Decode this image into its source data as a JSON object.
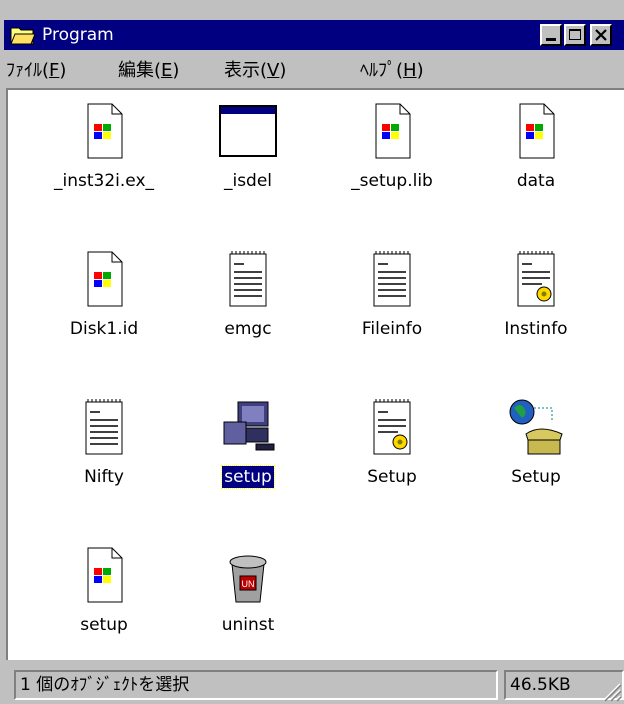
{
  "window": {
    "title": "Program",
    "title_bar_color": "#000080",
    "face_color": "#c0c0c0",
    "title_icon": "folder-open-icon",
    "controls": [
      "minimize",
      "maximize",
      "close"
    ]
  },
  "menu": [
    {
      "text": "ﾌｧｲﾙ",
      "key": "F"
    },
    {
      "text": "編集",
      "key": "E"
    },
    {
      "text": "表示",
      "key": "V"
    },
    {
      "text": "ﾍﾙﾌﾟ",
      "key": "H"
    }
  ],
  "files": [
    {
      "label": "_inst32i.ex_",
      "icon": "windows-doc-icon",
      "selected": false
    },
    {
      "label": "_isdel",
      "icon": "application-window-icon",
      "selected": false
    },
    {
      "label": "_setup.lib",
      "icon": "windows-doc-icon",
      "selected": false
    },
    {
      "label": "data",
      "icon": "windows-doc-icon",
      "selected": false
    },
    {
      "label": "Disk1.id",
      "icon": "windows-doc-icon",
      "selected": false
    },
    {
      "label": "emgc",
      "icon": "text-notepad-icon",
      "selected": false
    },
    {
      "label": "Fileinfo",
      "icon": "text-notepad-icon",
      "selected": false
    },
    {
      "label": "Instinfo",
      "icon": "settings-notepad-icon",
      "selected": false
    },
    {
      "label": "Nifty",
      "icon": "text-notepad-icon",
      "selected": false
    },
    {
      "label": "setup",
      "icon": "setup-computer-icon",
      "selected": true
    },
    {
      "label": "Setup",
      "icon": "settings-notepad-icon",
      "selected": false
    },
    {
      "label": "Setup",
      "icon": "dialup-globe-phone-icon",
      "selected": false
    },
    {
      "label": "setup",
      "icon": "windows-doc-icon",
      "selected": false
    },
    {
      "label": "uninst",
      "icon": "uninstall-trash-icon",
      "selected": false
    }
  ],
  "status": {
    "selection": "1 個のｵﾌﾞｼﾞｪｸﾄを選択",
    "size": "46.5KB"
  }
}
